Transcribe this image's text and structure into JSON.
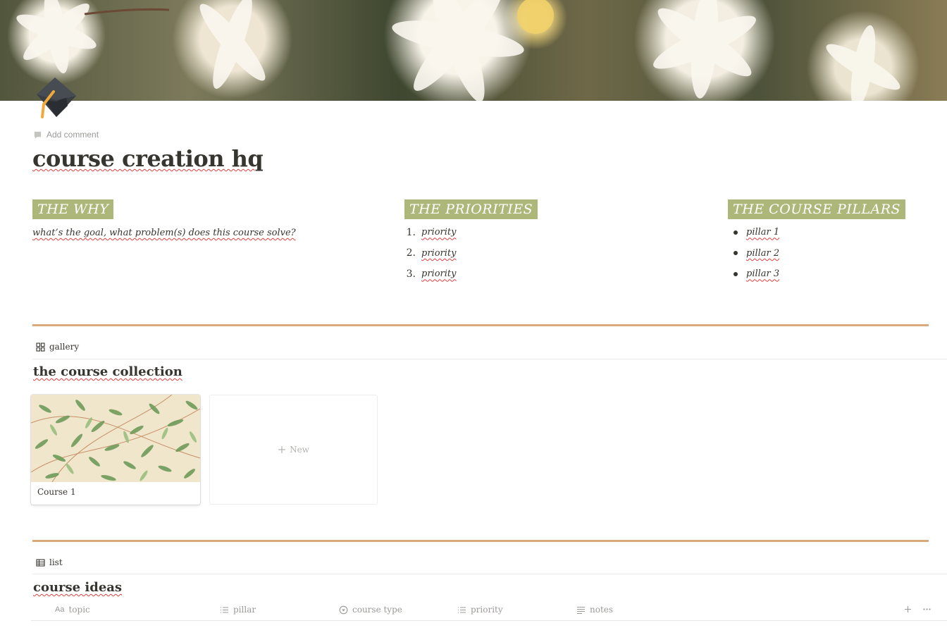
{
  "page": {
    "icon": "graduation-cap-icon",
    "add_comment_label": "Add comment",
    "title": "course creation hq"
  },
  "columns": {
    "why": {
      "heading": "THE WHY",
      "text": "what’s the goal, what problem(s) does this course solve?"
    },
    "priorities": {
      "heading": "THE PRIORITIES",
      "items": [
        {
          "marker": "1.",
          "text": "priority"
        },
        {
          "marker": "2.",
          "text": "priority"
        },
        {
          "marker": "3.",
          "text": "priority"
        }
      ]
    },
    "pillars": {
      "heading": "THE COURSE PILLARS",
      "items": [
        "pillar 1",
        "pillar 2",
        "pillar 3"
      ]
    }
  },
  "gallery": {
    "view_label": "gallery",
    "title": "the course collection",
    "cards": [
      {
        "title": "Course 1"
      }
    ],
    "new_label": "New"
  },
  "list": {
    "view_label": "list",
    "title": "course ideas",
    "columns": [
      {
        "label": "topic",
        "icon": "text-aa-icon"
      },
      {
        "label": "pillar",
        "icon": "list-icon"
      },
      {
        "label": "course type",
        "icon": "select-icon"
      },
      {
        "label": "priority",
        "icon": "list-icon"
      },
      {
        "label": "notes",
        "icon": "lines-icon"
      }
    ]
  },
  "colors": {
    "heading_tag_bg": "#adb77a",
    "divider": "#d9a97b",
    "spellcheck": "#e03e3e"
  }
}
